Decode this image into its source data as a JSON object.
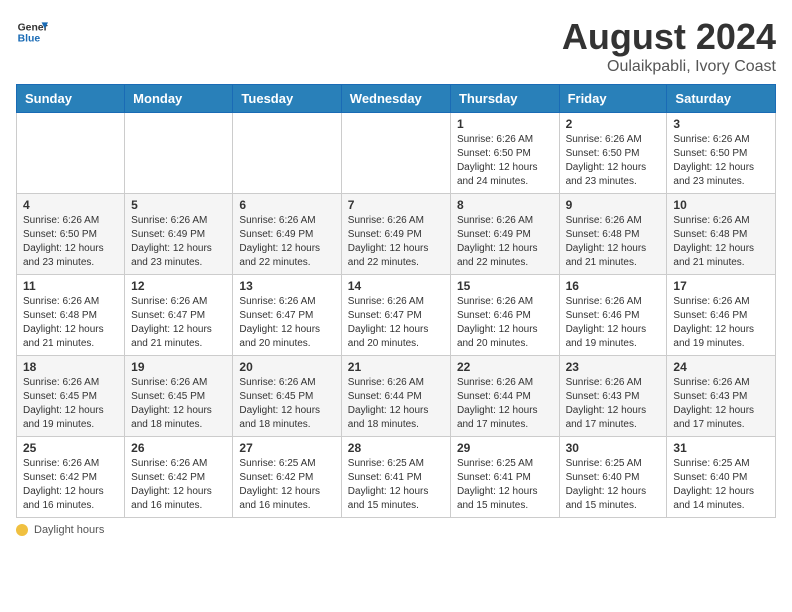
{
  "header": {
    "logo_general": "General",
    "logo_blue": "Blue",
    "month_year": "August 2024",
    "location": "Oulaikpabli, Ivory Coast"
  },
  "days_of_week": [
    "Sunday",
    "Monday",
    "Tuesday",
    "Wednesday",
    "Thursday",
    "Friday",
    "Saturday"
  ],
  "weeks": [
    [
      {
        "day": "",
        "info": ""
      },
      {
        "day": "",
        "info": ""
      },
      {
        "day": "",
        "info": ""
      },
      {
        "day": "",
        "info": ""
      },
      {
        "day": "1",
        "info": "Sunrise: 6:26 AM\nSunset: 6:50 PM\nDaylight: 12 hours\nand 24 minutes."
      },
      {
        "day": "2",
        "info": "Sunrise: 6:26 AM\nSunset: 6:50 PM\nDaylight: 12 hours\nand 23 minutes."
      },
      {
        "day": "3",
        "info": "Sunrise: 6:26 AM\nSunset: 6:50 PM\nDaylight: 12 hours\nand 23 minutes."
      }
    ],
    [
      {
        "day": "4",
        "info": "Sunrise: 6:26 AM\nSunset: 6:50 PM\nDaylight: 12 hours\nand 23 minutes."
      },
      {
        "day": "5",
        "info": "Sunrise: 6:26 AM\nSunset: 6:49 PM\nDaylight: 12 hours\nand 23 minutes."
      },
      {
        "day": "6",
        "info": "Sunrise: 6:26 AM\nSunset: 6:49 PM\nDaylight: 12 hours\nand 22 minutes."
      },
      {
        "day": "7",
        "info": "Sunrise: 6:26 AM\nSunset: 6:49 PM\nDaylight: 12 hours\nand 22 minutes."
      },
      {
        "day": "8",
        "info": "Sunrise: 6:26 AM\nSunset: 6:49 PM\nDaylight: 12 hours\nand 22 minutes."
      },
      {
        "day": "9",
        "info": "Sunrise: 6:26 AM\nSunset: 6:48 PM\nDaylight: 12 hours\nand 21 minutes."
      },
      {
        "day": "10",
        "info": "Sunrise: 6:26 AM\nSunset: 6:48 PM\nDaylight: 12 hours\nand 21 minutes."
      }
    ],
    [
      {
        "day": "11",
        "info": "Sunrise: 6:26 AM\nSunset: 6:48 PM\nDaylight: 12 hours\nand 21 minutes."
      },
      {
        "day": "12",
        "info": "Sunrise: 6:26 AM\nSunset: 6:47 PM\nDaylight: 12 hours\nand 21 minutes."
      },
      {
        "day": "13",
        "info": "Sunrise: 6:26 AM\nSunset: 6:47 PM\nDaylight: 12 hours\nand 20 minutes."
      },
      {
        "day": "14",
        "info": "Sunrise: 6:26 AM\nSunset: 6:47 PM\nDaylight: 12 hours\nand 20 minutes."
      },
      {
        "day": "15",
        "info": "Sunrise: 6:26 AM\nSunset: 6:46 PM\nDaylight: 12 hours\nand 20 minutes."
      },
      {
        "day": "16",
        "info": "Sunrise: 6:26 AM\nSunset: 6:46 PM\nDaylight: 12 hours\nand 19 minutes."
      },
      {
        "day": "17",
        "info": "Sunrise: 6:26 AM\nSunset: 6:46 PM\nDaylight: 12 hours\nand 19 minutes."
      }
    ],
    [
      {
        "day": "18",
        "info": "Sunrise: 6:26 AM\nSunset: 6:45 PM\nDaylight: 12 hours\nand 19 minutes."
      },
      {
        "day": "19",
        "info": "Sunrise: 6:26 AM\nSunset: 6:45 PM\nDaylight: 12 hours\nand 18 minutes."
      },
      {
        "day": "20",
        "info": "Sunrise: 6:26 AM\nSunset: 6:45 PM\nDaylight: 12 hours\nand 18 minutes."
      },
      {
        "day": "21",
        "info": "Sunrise: 6:26 AM\nSunset: 6:44 PM\nDaylight: 12 hours\nand 18 minutes."
      },
      {
        "day": "22",
        "info": "Sunrise: 6:26 AM\nSunset: 6:44 PM\nDaylight: 12 hours\nand 17 minutes."
      },
      {
        "day": "23",
        "info": "Sunrise: 6:26 AM\nSunset: 6:43 PM\nDaylight: 12 hours\nand 17 minutes."
      },
      {
        "day": "24",
        "info": "Sunrise: 6:26 AM\nSunset: 6:43 PM\nDaylight: 12 hours\nand 17 minutes."
      }
    ],
    [
      {
        "day": "25",
        "info": "Sunrise: 6:26 AM\nSunset: 6:42 PM\nDaylight: 12 hours\nand 16 minutes."
      },
      {
        "day": "26",
        "info": "Sunrise: 6:26 AM\nSunset: 6:42 PM\nDaylight: 12 hours\nand 16 minutes."
      },
      {
        "day": "27",
        "info": "Sunrise: 6:25 AM\nSunset: 6:42 PM\nDaylight: 12 hours\nand 16 minutes."
      },
      {
        "day": "28",
        "info": "Sunrise: 6:25 AM\nSunset: 6:41 PM\nDaylight: 12 hours\nand 15 minutes."
      },
      {
        "day": "29",
        "info": "Sunrise: 6:25 AM\nSunset: 6:41 PM\nDaylight: 12 hours\nand 15 minutes."
      },
      {
        "day": "30",
        "info": "Sunrise: 6:25 AM\nSunset: 6:40 PM\nDaylight: 12 hours\nand 15 minutes."
      },
      {
        "day": "31",
        "info": "Sunrise: 6:25 AM\nSunset: 6:40 PM\nDaylight: 12 hours\nand 14 minutes."
      }
    ]
  ],
  "footer": {
    "daylight_label": "Daylight hours"
  }
}
